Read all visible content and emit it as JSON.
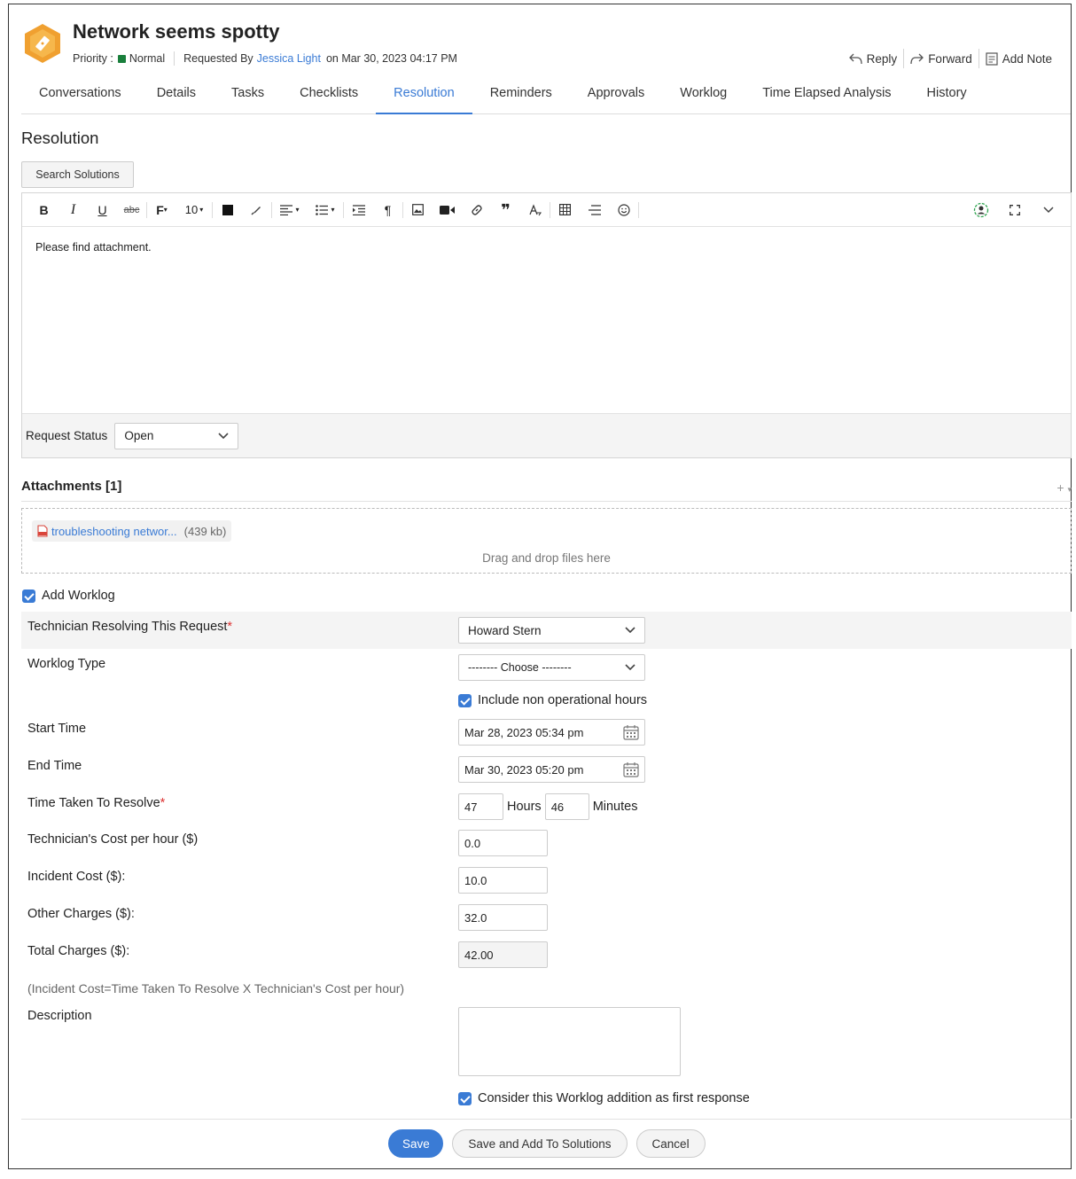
{
  "header": {
    "title": "Network seems spotty",
    "priority_label": "Priority :",
    "priority_value": "Normal",
    "priority_color": "#1a7f3c",
    "requested_by_label": "Requested By",
    "requester": "Jessica Light",
    "requested_on": "on Mar 30, 2023 04:17 PM",
    "actions": {
      "reply": "Reply",
      "forward": "Forward",
      "add_note": "Add Note"
    }
  },
  "tabs": [
    "Conversations",
    "Details",
    "Tasks",
    "Checklists",
    "Resolution",
    "Reminders",
    "Approvals",
    "Worklog",
    "Time Elapsed Analysis",
    "History"
  ],
  "active_tab": "Resolution",
  "resolution": {
    "title": "Resolution",
    "search_solutions": "Search Solutions",
    "toolbar": {
      "bold": "B",
      "italic": "I",
      "underline": "U",
      "strike": "abc",
      "font": "F",
      "font_size": "10"
    },
    "editor_text": "Please find attachment.",
    "request_status_label": "Request Status",
    "request_status_value": "Open"
  },
  "attachments": {
    "title": "Attachments [1]",
    "plus": "+",
    "file_name": "troubleshooting networ...",
    "file_size": "(439 kb)",
    "drop_text": "Drag and drop files here"
  },
  "worklog": {
    "add_worklog_label": "Add Worklog",
    "technician_label": "Technician Resolving This Request",
    "technician_value": "Howard Stern",
    "worklog_type_label": "Worklog Type",
    "worklog_type_value": "-------- Choose --------",
    "include_non_operational": "Include non operational hours",
    "start_time_label": "Start Time",
    "start_time_value": "Mar 28, 2023 05:34 pm",
    "end_time_label": "End Time",
    "end_time_value": "Mar 30, 2023 05:20 pm",
    "time_taken_label": "Time Taken To Resolve",
    "hours_value": "47",
    "hours_label": "Hours",
    "minutes_value": "46",
    "minutes_label": "Minutes",
    "tech_cost_label": "Technician's Cost per hour ($)",
    "tech_cost_value": "0.0",
    "incident_cost_label": "Incident Cost ($):",
    "incident_cost_value": "10.0",
    "other_charges_label": "Other Charges ($):",
    "other_charges_value": "32.0",
    "total_charges_label": "Total Charges ($):",
    "total_charges_value": "42.00",
    "formula_note": "(Incident Cost=Time Taken To Resolve X Technician's Cost per hour)",
    "description_label": "Description",
    "first_response_label": "Consider this Worklog addition as first response"
  },
  "buttons": {
    "save": "Save",
    "save_add": "Save and Add To Solutions",
    "cancel": "Cancel"
  },
  "colors": {
    "accent": "#3a7bd5",
    "logo": "#f0a030",
    "required": "#d33"
  }
}
